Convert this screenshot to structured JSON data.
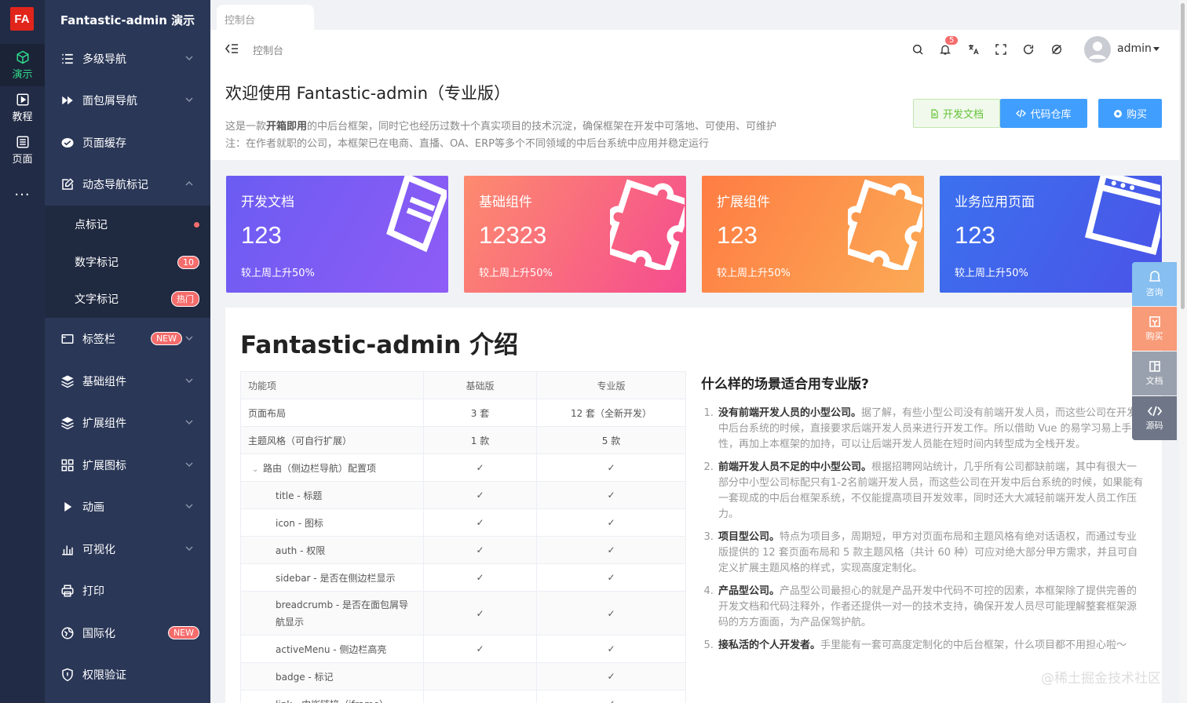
{
  "main_sidebar": {
    "logo": "FA",
    "items": [
      {
        "label": "演示",
        "icon": "cube-icon"
      },
      {
        "label": "教程",
        "icon": "play-icon"
      },
      {
        "label": "页面",
        "icon": "list-icon"
      }
    ],
    "more": "···"
  },
  "sub_sidebar": {
    "brand": "Fantastic-admin 演示",
    "items": [
      {
        "label": "多级导航",
        "icon": "menu-list-icon"
      },
      {
        "label": "面包屑导航",
        "icon": "forward-icon"
      },
      {
        "label": "页面缓存",
        "icon": "cache-icon"
      },
      {
        "label": "动态导航标记",
        "icon": "edit-icon"
      },
      {
        "label": "标签栏",
        "icon": "window-icon",
        "badge": "NEW"
      },
      {
        "label": "基础组件",
        "icon": "layers-icon"
      },
      {
        "label": "扩展组件",
        "icon": "layers-icon"
      },
      {
        "label": "扩展图标",
        "icon": "grid-icon"
      },
      {
        "label": "动画",
        "icon": "play-triangle-icon"
      },
      {
        "label": "可视化",
        "icon": "bar-chart-icon"
      },
      {
        "label": "打印",
        "icon": "printer-icon"
      },
      {
        "label": "国际化",
        "icon": "globe-icon",
        "badge": "NEW"
      },
      {
        "label": "权限验证",
        "icon": "shield-icon"
      }
    ],
    "sub_items": [
      {
        "label": "点标记"
      },
      {
        "label": "数字标记",
        "badge": "10"
      },
      {
        "label": "文字标记",
        "badge": "热门"
      }
    ]
  },
  "tabbar": {
    "tab": "控制台"
  },
  "header": {
    "breadcrumb": "控制台",
    "notification_count": "5",
    "user": "admin"
  },
  "welcome": {
    "title": "欢迎使用 Fantastic-admin（专业版）",
    "desc_prefix": "这是一款",
    "desc_bold": "开箱即用",
    "desc_suffix": "的中后台框架，同时它也经历过数十个真实项目的技术沉淀，确保框架在开发中可落地、可使用、可维护",
    "desc2": "注：在作者就职的公司，本框架已在电商、直播、OA、ERP等多个不同领域的中后台系统中应用并稳定运行",
    "buttons": {
      "docs": "开发文档",
      "repo": "代码仓库",
      "buy": "购买"
    }
  },
  "cards": [
    {
      "title": "开发文档",
      "value": "123",
      "sub": "较上周上升50%",
      "color_from": "#6b5cf2",
      "color_to": "#8f5cf6"
    },
    {
      "title": "基础组件",
      "value": "12323",
      "sub": "较上周上升50%",
      "color_from": "#fd8b6e",
      "color_to": "#f54c8f"
    },
    {
      "title": "扩展组件",
      "value": "123",
      "sub": "较上周上升50%",
      "color_from": "#ff7c43",
      "color_to": "#fbaa55"
    },
    {
      "title": "业务应用页面",
      "value": "123",
      "sub": "较上周上升50%",
      "color_from": "#3b71ee",
      "color_to": "#4b53e8"
    }
  ],
  "intro": {
    "title": "Fantastic-admin 介绍",
    "table": {
      "headers": [
        "功能项",
        "基础版",
        "专业版"
      ],
      "rows": [
        {
          "name": "页面布局",
          "basic": "3 套",
          "pro": "12 套（全新开发）",
          "indent": 0
        },
        {
          "name": "主题风格（可自行扩展）",
          "basic": "1 款",
          "pro": "5 款",
          "indent": 0
        },
        {
          "name": "路由（侧边栏导航）配置项",
          "basic": "✓",
          "pro": "✓",
          "indent": 1
        },
        {
          "name": "title - 标题",
          "basic": "✓",
          "pro": "✓",
          "indent": 2
        },
        {
          "name": "icon - 图标",
          "basic": "✓",
          "pro": "✓",
          "indent": 2
        },
        {
          "name": "auth - 权限",
          "basic": "✓",
          "pro": "✓",
          "indent": 2
        },
        {
          "name": "sidebar - 是否在侧边栏显示",
          "basic": "✓",
          "pro": "✓",
          "indent": 2
        },
        {
          "name": "breadcrumb - 是否在面包屑导航显示",
          "basic": "✓",
          "pro": "✓",
          "indent": 2
        },
        {
          "name": "activeMenu - 侧边栏高亮",
          "basic": "✓",
          "pro": "✓",
          "indent": 2
        },
        {
          "name": "badge - 标记",
          "basic": "",
          "pro": "✓",
          "indent": 2
        },
        {
          "name": "link - 内嵌链接（iframe）",
          "basic": "",
          "pro": "✓",
          "indent": 2
        }
      ]
    },
    "question": "什么样的场景适合用专业版?",
    "reasons": [
      {
        "bold": "没有前端开发人员的小型公司。",
        "text": "据了解，有些小型公司没有前端开发人员，而这些公司在开发中后台系统的时候，直接要求后端开发人员来进行开发工作。所以借助 Vue 的易学习易上手特性，再加上本框架的加持，可以让后端开发人员能在短时间内转型成为全栈开发。"
      },
      {
        "bold": "前端开发人员不足的中小型公司。",
        "text": "根据招聘网站统计，几乎所有公司都缺前端，其中有很大一部分中小型公司标配只有1-2名前端开发人员，而这些公司在开发中后台系统的时候，如果能有一套现成的中后台框架系统，不仅能提高项目开发效率，同时还大大减轻前端开发人员工作压力。"
      },
      {
        "bold": "项目型公司。",
        "text": "特点为项目多，周期短，甲方对页面布局和主题风格有绝对话语权，而通过专业版提供的 12 套页面布局和 5 款主题风格（共计 60 种）可应对绝大部分甲方需求，并且可自定义扩展主题风格的样式，实现高度定制化。"
      },
      {
        "bold": "产品型公司。",
        "text": "产品型公司最担心的就是产品开发中代码不可控的因素，本框架除了提供完善的开发文档和代码注释外，作者还提供一对一的技术支持，确保开发人员尽可能理解整套框架源码的方方面面，为产品保驾护航。"
      },
      {
        "bold": "接私活的个人开发者。",
        "text": "手里能有一套可高度定制化的中后台框架，什么项目都不用担心啦～"
      }
    ]
  },
  "dock": [
    {
      "label": "咨询",
      "icon": "chat-icon",
      "color": "#86bff0"
    },
    {
      "label": "购买",
      "icon": "cart-icon",
      "color": "#f89b78"
    },
    {
      "label": "文档",
      "icon": "book-icon",
      "color": "#9aa1ae"
    },
    {
      "label": "源码",
      "icon": "code-icon",
      "color": "#6e7687"
    }
  ],
  "watermark": "@稀土掘金技术社区"
}
